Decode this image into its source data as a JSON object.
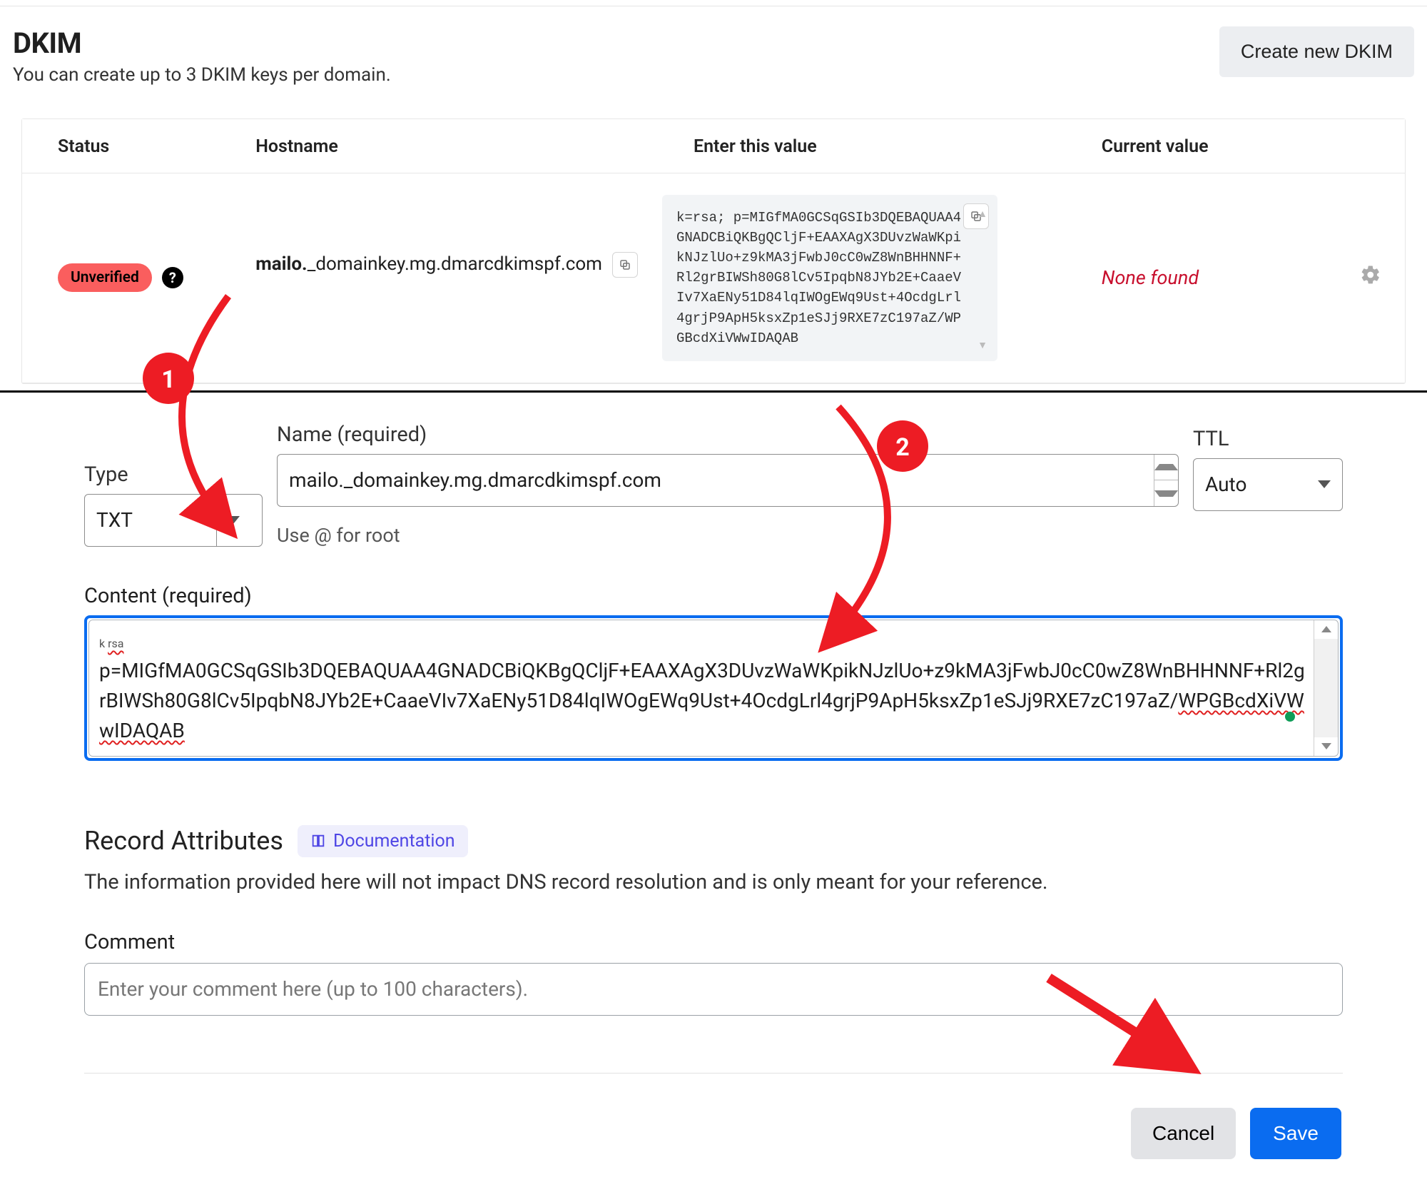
{
  "dkim": {
    "title": "DKIM",
    "subtitle": "You can create up to 3 DKIM keys per domain.",
    "create_button": "Create new DKIM",
    "columns": {
      "status": "Status",
      "hostname": "Hostname",
      "enter_value": "Enter this value",
      "current_value": "Current value"
    },
    "row": {
      "status_badge": "Unverified",
      "hostname_prefix": "mailo.",
      "hostname_rest": "_domainkey.mg.dmarcdkimspf.com",
      "enter_value": "k=rsa; p=MIGfMA0GCSqGSIb3DQEBAQUAA4GNADCBiQKBgQCljF+EAAXAgX3DUvzWaWKpikNJzlUo+z9kMA3jFwbJ0cC0wZ8WnBHHNNF+Rl2grBIWSh80G8lCv5IpqbN8JYb2E+CaaeVIv7XaENy51D84lqIWOgEWq9Ust+4OcdgLrl4grjP9ApH5ksxZp1eSJj9RXE7zC197aZ/WPGBcdXiVWwIDAQAB",
      "current_value": "None found"
    }
  },
  "editor": {
    "type_label": "Type",
    "type_value": "TXT",
    "name_label": "Name (required)",
    "name_value": "mailo._domainkey.mg.dmarcdkimspf.com",
    "name_hint": "Use @ for root",
    "ttl_label": "TTL",
    "ttl_value": "Auto",
    "content_label": "Content (required)",
    "content_k_prefix": "k",
    "content_value": "p=MIGfMA0GCSqGSIb3DQEBAQUAA4GNADCBiQKBgQCljF+EAAXAgX3DUvzWaWKpikNJzlUo+z9kMA3jFwbJ0cC0wZ8WnBHHNNF+Rl2grBIWSh80G8lCv5IpqbN8JYb2E+CaaeVIv7XaENy51D84lqIWOgEWq9Ust+4OcdgLrl4grjP9ApH5ksxZp1eSJj9RXE7zC197aZ/",
    "content_tail": "WPGBcdXiVWwIDAQAB",
    "record_attributes_title": "Record Attributes",
    "documentation_label": "Documentation",
    "record_attributes_desc": "The information provided here will not impact DNS record resolution and is only meant for your reference.",
    "comment_label": "Comment",
    "comment_placeholder": "Enter your comment here (up to 100 characters).",
    "cancel": "Cancel",
    "save": "Save"
  },
  "annotations": {
    "badge1": "1",
    "badge2": "2"
  }
}
